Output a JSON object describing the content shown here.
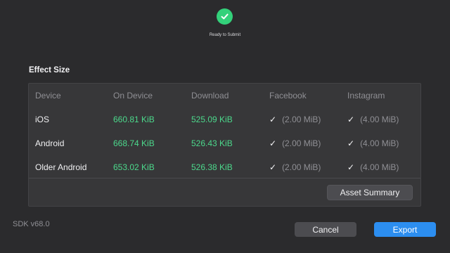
{
  "status": {
    "icon": "check-circle-icon",
    "text": "Ready to Submit",
    "color": "#33d17a"
  },
  "section": {
    "title": "Effect Size"
  },
  "table": {
    "headers": [
      "Device",
      "On Device",
      "Download",
      "Facebook",
      "Instagram"
    ],
    "rows": [
      {
        "device": "iOS",
        "on_device": "660.81 KiB",
        "download": "525.09 KiB",
        "facebook_check": "✓",
        "facebook_limit": "(2.00 MiB)",
        "instagram_check": "✓",
        "instagram_limit": "(4.00 MiB)"
      },
      {
        "device": "Android",
        "on_device": "668.74 KiB",
        "download": "526.43 KiB",
        "facebook_check": "✓",
        "facebook_limit": "(2.00 MiB)",
        "instagram_check": "✓",
        "instagram_limit": "(4.00 MiB)"
      },
      {
        "device": "Older Android",
        "on_device": "653.02 KiB",
        "download": "526.38 KiB",
        "facebook_check": "✓",
        "facebook_limit": "(2.00 MiB)",
        "instagram_check": "✓",
        "instagram_limit": "(4.00 MiB)"
      }
    ],
    "value_color": "#4cd98c"
  },
  "buttons": {
    "asset_summary": "Asset Summary",
    "cancel": "Cancel",
    "export": "Export",
    "export_color": "#2c8ef0"
  },
  "footer": {
    "sdk_version": "SDK v68.0"
  }
}
